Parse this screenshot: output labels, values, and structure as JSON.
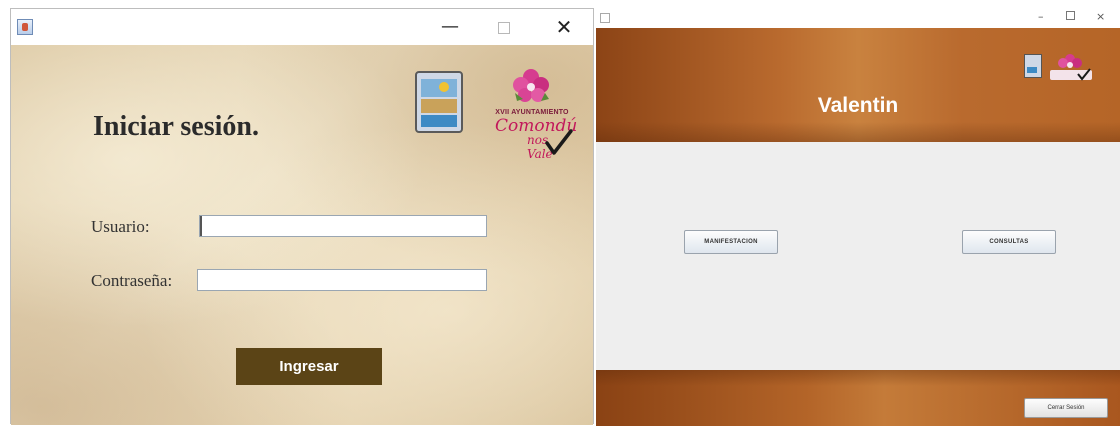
{
  "login_window": {
    "controls": {
      "minimize": "—",
      "close": "✕"
    },
    "title": "Iniciar sesión.",
    "logo": {
      "municipality_line": "XVII AYUNTAMIENTO",
      "slogan_script": "Comondú",
      "slogan_small": "nos Vale"
    },
    "fields": {
      "user_label": "Usuario:",
      "user_value": "",
      "password_label": "Contraseña:",
      "password_value": ""
    },
    "submit_label": "Ingresar",
    "colors": {
      "submit_bg": "#5b4416",
      "parchment": "#e6d4b2"
    }
  },
  "menu_window": {
    "controls": {
      "minimize": "–",
      "close": "×"
    },
    "username": "Valentin",
    "buttons": {
      "manifestacion": "MANIFESTACION",
      "consultas": "CONSULTAS"
    },
    "logout_label": "Cerrar Sesión",
    "colors": {
      "header_brown": "#b96a2e",
      "body_gray": "#eeeeee"
    }
  }
}
